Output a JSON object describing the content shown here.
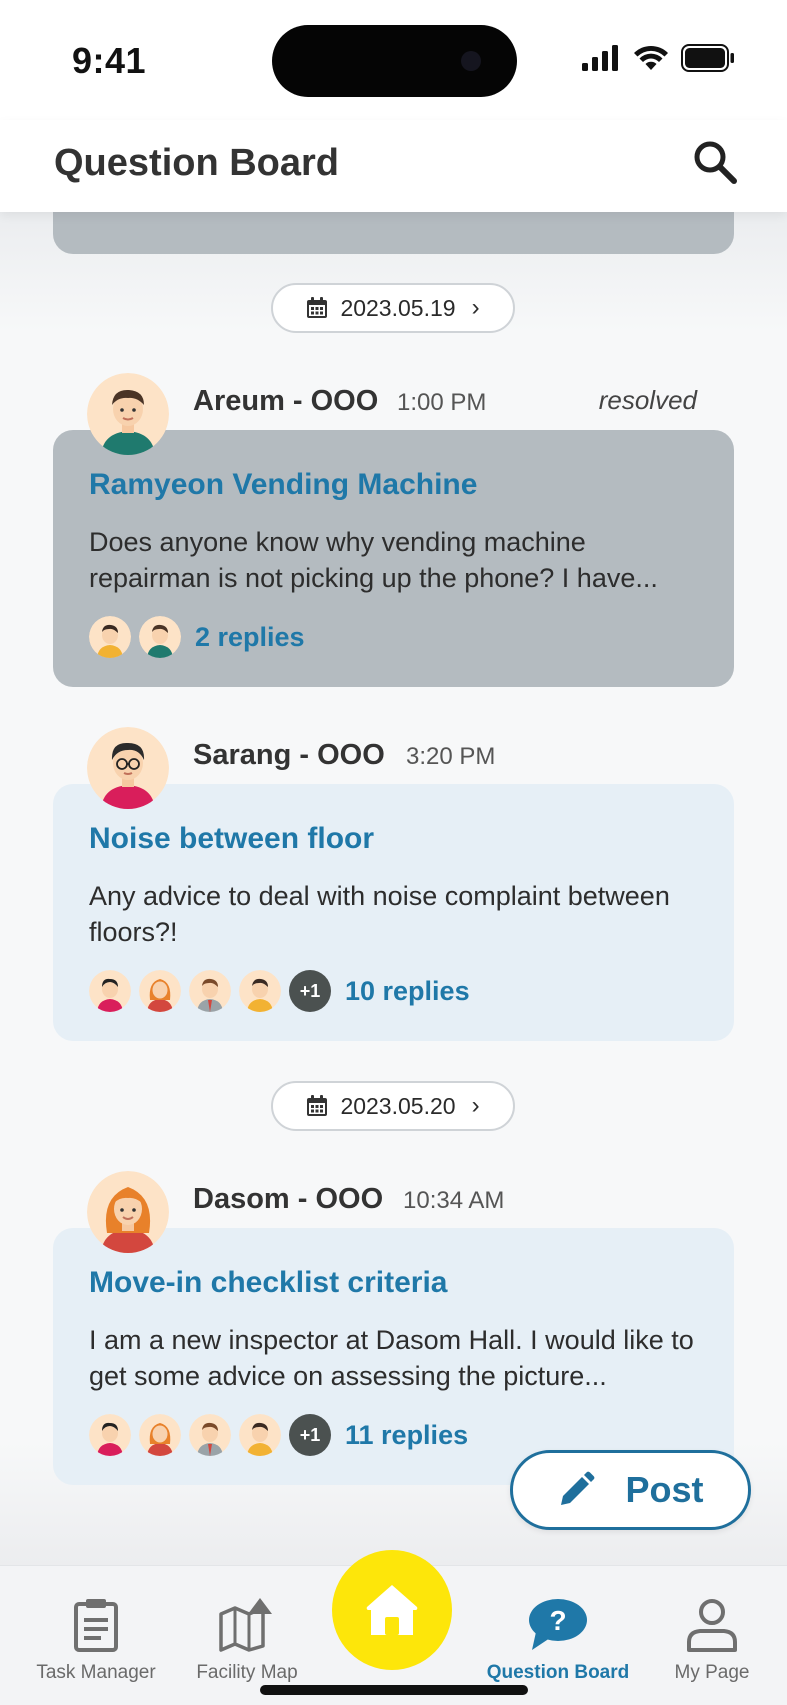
{
  "status_bar": {
    "time": "9:41"
  },
  "header": {
    "title": "Question Board"
  },
  "feed": {
    "groups": [
      {
        "date": "2023.05.19",
        "posts": [
          {
            "author": "Areum - OOO",
            "time": "1:00 PM",
            "status": "resolved",
            "title": "Ramyeon Vending Machine",
            "body": "Does anyone know why vending machine repairman is not picking up the phone? I have...",
            "replies_label": "2 replies"
          },
          {
            "author": "Sarang - OOO",
            "time": "3:20 PM",
            "status": "",
            "title": "Noise between floor",
            "body": "Any advice to deal with noise complaint between floors?!",
            "more_label": "+1",
            "replies_label": "10 replies"
          }
        ]
      },
      {
        "date": "2023.05.20",
        "posts": [
          {
            "author": "Dasom - OOO",
            "time": "10:34 AM",
            "status": "",
            "title": "Move-in checklist criteria",
            "body": "I am a new inspector at Dasom Hall. I would like to get some advice on assessing the picture...",
            "more_label": "+1",
            "replies_label": "11 replies"
          }
        ]
      }
    ]
  },
  "fab": {
    "label": "Post"
  },
  "bottom_nav": {
    "items": [
      {
        "label": "Task Manager",
        "icon": "clipboard-icon"
      },
      {
        "label": "Facility Map",
        "icon": "map-icon"
      },
      {
        "label": "",
        "icon": "home-icon"
      },
      {
        "label": "Question Board",
        "icon": "question-bubble-icon",
        "active": true
      },
      {
        "label": "My Page",
        "icon": "person-icon"
      }
    ]
  },
  "colors": {
    "accent": "#1f78a8",
    "resolved_card": "#b4bbc0",
    "open_card": "#e6eff6",
    "home_button": "#fde60a"
  }
}
